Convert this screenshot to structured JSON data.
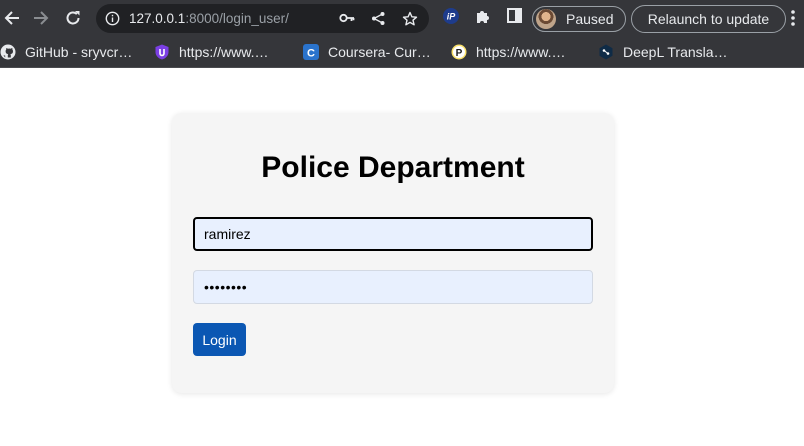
{
  "browser": {
    "url_host": "127.0.0.1",
    "url_path": ":8000/login_user/",
    "profile_status": "Paused",
    "relaunch_label": "Relaunch to update",
    "ext_ip_label": "iP"
  },
  "bookmarks": [
    {
      "label": "GitHub - sryvcr…",
      "icon": "github-icon"
    },
    {
      "label": "https://www.…",
      "icon": "purple-shield-icon"
    },
    {
      "label": "Coursera- Cur…",
      "icon": "coursera-icon"
    },
    {
      "label": "https://www.…",
      "icon": "p-icon"
    },
    {
      "label": "DeepL Transla…",
      "icon": "deepl-icon"
    }
  ],
  "bookmark_icon_letters": {
    "coursera": "C",
    "p": "P"
  },
  "page": {
    "title": "Police Department",
    "username_value": "ramirez",
    "password_mask": "••••••••",
    "login_label": "Login"
  },
  "colors": {
    "toolbar": "#35363a",
    "card": "#f5f5f5",
    "input_fill": "#e8f0fe",
    "login_button": "#0b57b3"
  }
}
